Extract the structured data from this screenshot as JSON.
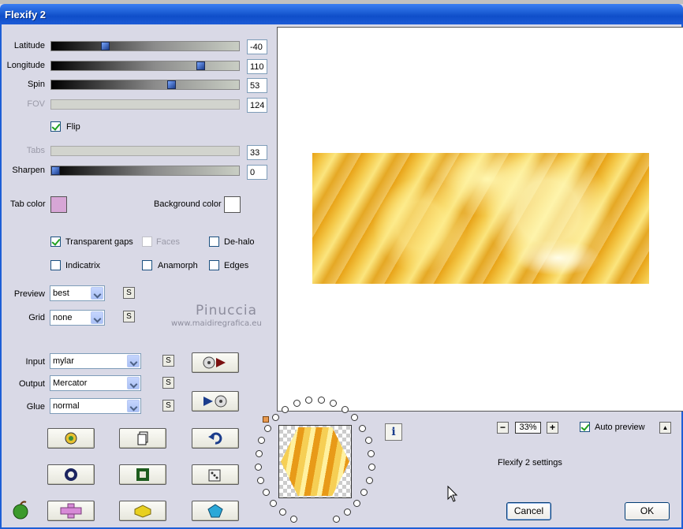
{
  "window": {
    "title": "Flexify 2"
  },
  "sliders": [
    {
      "label": "Latitude",
      "value": "-40",
      "enabled": true,
      "pos": 0.3
    },
    {
      "label": "Longitude",
      "value": "110",
      "enabled": true,
      "pos": 0.8
    },
    {
      "label": "Spin",
      "value": "53",
      "enabled": true,
      "pos": 0.64
    },
    {
      "label": "FOV",
      "value": "124",
      "enabled": false
    },
    {
      "label": "Tabs",
      "value": "33",
      "enabled": false
    },
    {
      "label": "Sharpen",
      "value": "0",
      "enabled": true,
      "pos": 0.0
    }
  ],
  "flip": {
    "label": "Flip",
    "checked": true
  },
  "colors": {
    "tab_color_label": "Tab color",
    "tab_color": "#d7a6d6",
    "background_color_label": "Background color",
    "background_color": "#ffffff"
  },
  "options": {
    "transparent_gaps": "Transparent gaps",
    "faces": "Faces",
    "de_halo": "De-halo",
    "indicatrix": "Indicatrix",
    "anamorph": "Anamorph",
    "edges": "Edges"
  },
  "selects": {
    "preview_label": "Preview",
    "preview_value": "best",
    "grid_label": "Grid",
    "grid_value": "none",
    "input_label": "Input",
    "input_value": "mylar",
    "output_label": "Output",
    "output_value": "Mercator",
    "glue_label": "Glue",
    "glue_value": "normal"
  },
  "s_button_label": "S",
  "watermark": {
    "name": "Pinuccia",
    "url": "www.maidiregrafica.eu"
  },
  "zoom": {
    "minus": "−",
    "value": "33%",
    "plus": "+"
  },
  "auto_preview": {
    "label": "Auto preview",
    "checked": true,
    "scroll_up": "▲"
  },
  "settings_label": "Flexify 2 settings",
  "buttons": {
    "cancel": "Cancel",
    "ok": "OK",
    "info": "i"
  },
  "accent_colors": {
    "title_bar": "#1d5fd6",
    "panel": "#d9d9e6"
  }
}
